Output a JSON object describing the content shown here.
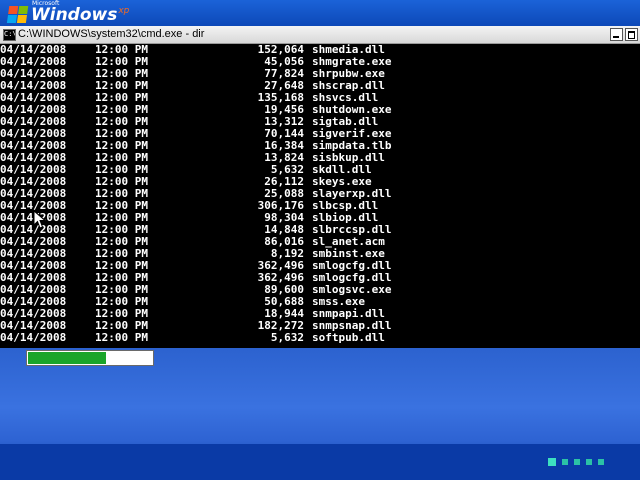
{
  "desktop": {
    "logo": {
      "microsoft": "Microsoft",
      "windows": "Windows",
      "xp": "xp"
    },
    "progress_fraction": 0.63
  },
  "window": {
    "title": "C:\\WINDOWS\\system32\\cmd.exe - dir",
    "minimize_icon": "minimize-icon",
    "maximize_icon": "maximize-icon"
  },
  "listing": [
    {
      "date": "04/14/2008",
      "time": "12:00 PM",
      "size": "152,064",
      "name": "shmedia.dll"
    },
    {
      "date": "04/14/2008",
      "time": "12:00 PM",
      "size": "45,056",
      "name": "shmgrate.exe"
    },
    {
      "date": "04/14/2008",
      "time": "12:00 PM",
      "size": "77,824",
      "name": "shrpubw.exe"
    },
    {
      "date": "04/14/2008",
      "time": "12:00 PM",
      "size": "27,648",
      "name": "shscrap.dll"
    },
    {
      "date": "04/14/2008",
      "time": "12:00 PM",
      "size": "135,168",
      "name": "shsvcs.dll"
    },
    {
      "date": "04/14/2008",
      "time": "12:00 PM",
      "size": "19,456",
      "name": "shutdown.exe"
    },
    {
      "date": "04/14/2008",
      "time": "12:00 PM",
      "size": "13,312",
      "name": "sigtab.dll"
    },
    {
      "date": "04/14/2008",
      "time": "12:00 PM",
      "size": "70,144",
      "name": "sigverif.exe"
    },
    {
      "date": "04/14/2008",
      "time": "12:00 PM",
      "size": "16,384",
      "name": "simpdata.tlb"
    },
    {
      "date": "04/14/2008",
      "time": "12:00 PM",
      "size": "13,824",
      "name": "sisbkup.dll"
    },
    {
      "date": "04/14/2008",
      "time": "12:00 PM",
      "size": "5,632",
      "name": "skdll.dll"
    },
    {
      "date": "04/14/2008",
      "time": "12:00 PM",
      "size": "26,112",
      "name": "skeys.exe"
    },
    {
      "date": "04/14/2008",
      "time": "12:00 PM",
      "size": "25,088",
      "name": "slayerxp.dll"
    },
    {
      "date": "04/14/2008",
      "time": "12:00 PM",
      "size": "306,176",
      "name": "slbcsp.dll"
    },
    {
      "date": "04/14/2008",
      "time": "12:00 PM",
      "size": "98,304",
      "name": "slbiop.dll"
    },
    {
      "date": "04/14/2008",
      "time": "12:00 PM",
      "size": "14,848",
      "name": "slbrccsp.dll"
    },
    {
      "date": "04/14/2008",
      "time": "12:00 PM",
      "size": "86,016",
      "name": "sl_anet.acm"
    },
    {
      "date": "04/14/2008",
      "time": "12:00 PM",
      "size": "8,192",
      "name": "smbinst.exe"
    },
    {
      "date": "04/14/2008",
      "time": "12:00 PM",
      "size": "362,496",
      "name": "smlogcfg.dll"
    },
    {
      "date": "04/14/2008",
      "time": "12:00 PM",
      "size": "362,496",
      "name": "smlogcfg.dll"
    },
    {
      "date": "04/14/2008",
      "time": "12:00 PM",
      "size": "89,600",
      "name": "smlogsvc.exe"
    },
    {
      "date": "04/14/2008",
      "time": "12:00 PM",
      "size": "50,688",
      "name": "smss.exe"
    },
    {
      "date": "04/14/2008",
      "time": "12:00 PM",
      "size": "18,944",
      "name": "snmpapi.dll"
    },
    {
      "date": "04/14/2008",
      "time": "12:00 PM",
      "size": "182,272",
      "name": "snmpsnap.dll"
    },
    {
      "date": "04/14/2008",
      "time": "12:00 PM",
      "size": "5,632",
      "name": "softpub.dll"
    }
  ],
  "colors": {
    "console_bg": "#000000",
    "console_fg": "#ffffff",
    "progress": "#1aa52a",
    "desktop": "#0a3fb0"
  }
}
